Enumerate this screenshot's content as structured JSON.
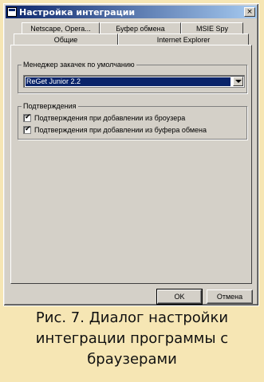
{
  "window": {
    "title": "Настройка интеграции",
    "close_label": "×"
  },
  "tabs": {
    "row_back": [
      "Netscape, Opera...",
      "Буфер обмена",
      "MSIE Spy"
    ],
    "row_front": [
      "Общие",
      "Internet Explorer"
    ],
    "active": "Общие"
  },
  "download_manager": {
    "group_label": "Менеджер закачек по умолчанию",
    "selected": "ReGet Junior 2.2"
  },
  "confirmations": {
    "group_label": "Подтверждения",
    "items": [
      {
        "label": "Подтверждения при добавлении из броузера",
        "checked": true
      },
      {
        "label": "Подтверждения при добавлении из буфера обмена",
        "checked": true
      }
    ]
  },
  "buttons": {
    "ok": "OK",
    "cancel": "Отмена"
  },
  "caption": {
    "line1": "Рис. 7. Диалог настройки",
    "line2": "интеграции программы с",
    "line3": "браузерами"
  }
}
